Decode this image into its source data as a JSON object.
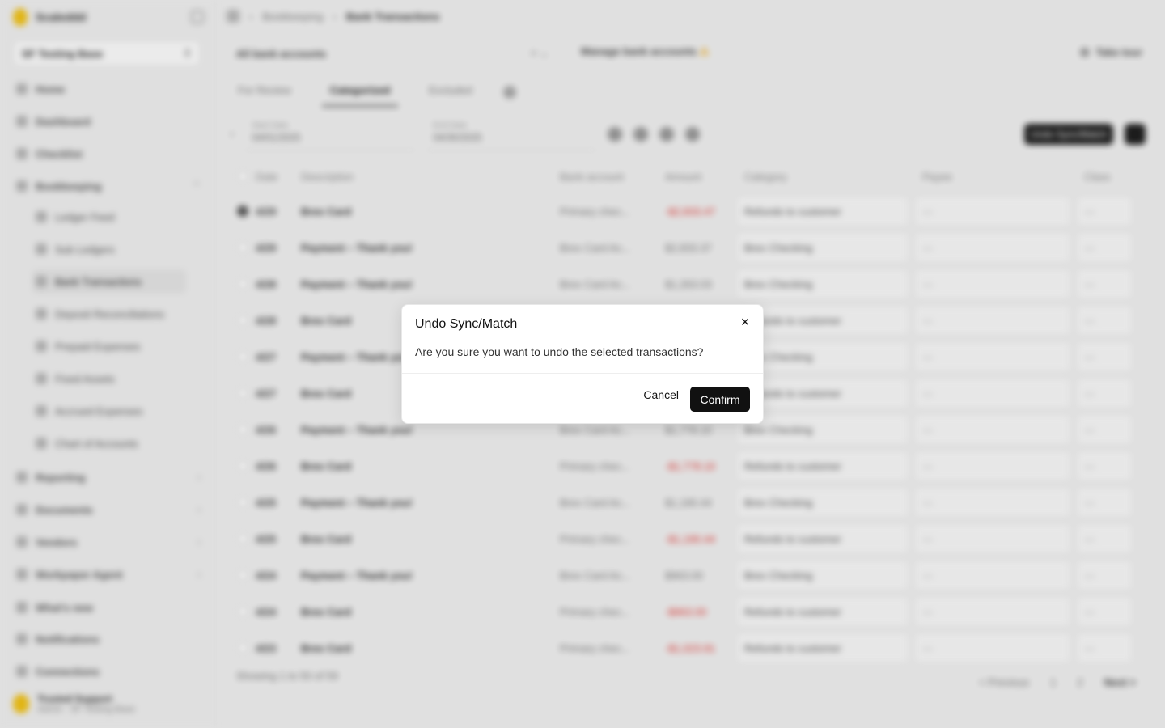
{
  "app": {
    "brand": "Scaleddd",
    "org": "SF Testing Base",
    "breadcrumb": [
      "Bookkeeping",
      "Bank Transactions"
    ],
    "nav": [
      {
        "label": "Home",
        "active": false
      },
      {
        "label": "Dashboard",
        "active": false
      },
      {
        "label": "Checklist",
        "active": false
      },
      {
        "label": "Bookkeeping",
        "active": false,
        "expanded": true
      },
      {
        "label": "Ledger Feed",
        "sub": true
      },
      {
        "label": "Sub Ledgers",
        "sub": true
      },
      {
        "label": "Bank Transactions",
        "sub": true,
        "active": true
      },
      {
        "label": "Deposit Reconciliations",
        "sub": true
      },
      {
        "label": "Prepaid Expenses",
        "sub": true
      },
      {
        "label": "Fixed Assets",
        "sub": true
      },
      {
        "label": "Accrued Expenses",
        "sub": true
      },
      {
        "label": "Chart of Accounts",
        "sub": true
      },
      {
        "label": "Reporting"
      },
      {
        "label": "Documents"
      },
      {
        "label": "Vendors"
      },
      {
        "label": "Workpaper Agent"
      },
      {
        "label": "What's new"
      },
      {
        "label": "Notifications"
      },
      {
        "label": "Connections"
      }
    ],
    "user": {
      "name": "Trusted Support",
      "role": "Admin · SF Testing Base"
    },
    "account_select": "All bank accounts",
    "manage_link": "Manage bank accounts",
    "tour": "Take tour",
    "tabs": [
      "For Review",
      "Categorized",
      "Excluded"
    ],
    "filters": {
      "from_label": "Start Date",
      "from_value": "04/01/2025",
      "to_label": "End Date",
      "to_value": "04/30/2025"
    },
    "undo_label": "Undo Sync/Match",
    "columns": [
      "Date",
      "Description",
      "Bank account",
      "Amount",
      "Category",
      "Payee",
      "Class"
    ],
    "rows": [
      {
        "date": "4/29",
        "desc": "Brex Card",
        "bank": "Primary chec...",
        "amt": "-$2,833.47",
        "neg": true,
        "cat": "Refunds to customer",
        "payee": "—",
        "cls": "—",
        "checked": true
      },
      {
        "date": "4/29",
        "desc": "Payment – Thank you!",
        "bank": "Brex Card Ac...",
        "amt": "$2,833.37",
        "neg": false,
        "cat": "Brex Checking",
        "payee": "—",
        "cls": "—"
      },
      {
        "date": "4/28",
        "desc": "Payment – Thank you!",
        "bank": "Brex Card Ac...",
        "amt": "$1,263.03",
        "neg": false,
        "cat": "Brex Checking",
        "payee": "—",
        "cls": "—"
      },
      {
        "date": "4/28",
        "desc": "Brex Card",
        "bank": "Primary chec...",
        "amt": "-$1,263.03",
        "neg": true,
        "cat": "Refunds to customer",
        "payee": "—",
        "cls": "—"
      },
      {
        "date": "4/27",
        "desc": "Payment – Thank you!",
        "bank": "Brex Card Ac...",
        "amt": "$845.00",
        "neg": false,
        "cat": "Brex Checking",
        "payee": "—",
        "cls": "—"
      },
      {
        "date": "4/27",
        "desc": "Brex Card",
        "bank": "Primary chec...",
        "amt": "-$845.00",
        "neg": true,
        "cat": "Refunds to customer",
        "payee": "—",
        "cls": "—"
      },
      {
        "date": "4/26",
        "desc": "Payment – Thank you!",
        "bank": "Brex Card Ac...",
        "amt": "$1,778.10",
        "neg": false,
        "cat": "Brex Checking",
        "payee": "—",
        "cls": "—"
      },
      {
        "date": "4/26",
        "desc": "Brex Card",
        "bank": "Primary chec...",
        "amt": "-$1,778.10",
        "neg": true,
        "cat": "Refunds to customer",
        "payee": "—",
        "cls": "—"
      },
      {
        "date": "4/25",
        "desc": "Payment – Thank you!",
        "bank": "Brex Card Ac...",
        "amt": "$1,190.44",
        "neg": false,
        "cat": "Brex Checking",
        "payee": "—",
        "cls": "—"
      },
      {
        "date": "4/25",
        "desc": "Brex Card",
        "bank": "Primary chec...",
        "amt": "-$1,190.44",
        "neg": true,
        "cat": "Refunds to customer",
        "payee": "—",
        "cls": "—"
      },
      {
        "date": "4/24",
        "desc": "Payment – Thank you!",
        "bank": "Brex Card Ac...",
        "amt": "$963.00",
        "neg": false,
        "cat": "Brex Checking",
        "payee": "—",
        "cls": "—"
      },
      {
        "date": "4/24",
        "desc": "Brex Card",
        "bank": "Primary chec...",
        "amt": "-$963.00",
        "neg": true,
        "cat": "Refunds to customer",
        "payee": "—",
        "cls": "—"
      },
      {
        "date": "4/23",
        "desc": "Brex Card",
        "bank": "Primary chec...",
        "amt": "-$1,023.91",
        "neg": true,
        "cat": "Refunds to customer",
        "payee": "—",
        "cls": "—"
      }
    ],
    "footer": {
      "count": "Showing 1 to 50 of 59",
      "prev": "< Previous",
      "pages": [
        "1",
        "2"
      ],
      "next": "Next >"
    }
  },
  "dialog": {
    "title": "Undo Sync/Match",
    "message": "Are you sure you want to undo the selected transactions?",
    "close_icon": "×",
    "cancel": "Cancel",
    "confirm": "Confirm"
  }
}
